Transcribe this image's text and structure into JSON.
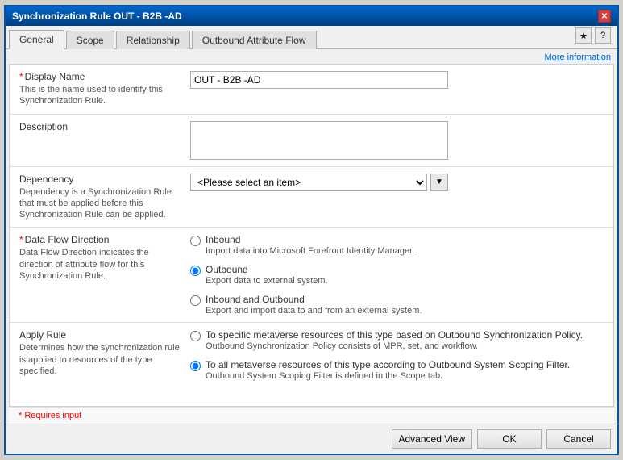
{
  "window": {
    "title": "Synchronization Rule OUT - B2B -AD",
    "close_label": "✕"
  },
  "tabs": [
    {
      "id": "general",
      "label": "General",
      "active": true
    },
    {
      "id": "scope",
      "label": "Scope",
      "active": false
    },
    {
      "id": "relationship",
      "label": "Relationship",
      "active": false
    },
    {
      "id": "outbound",
      "label": "Outbound Attribute Flow",
      "active": false
    }
  ],
  "tab_icons": {
    "star": "★",
    "help": "?"
  },
  "more_info": {
    "label": "More information"
  },
  "fields": {
    "display_name": {
      "label": "Display Name",
      "required": true,
      "description": "This is the name used to identify this Synchronization Rule.",
      "value": "OUT - B2B -AD"
    },
    "description": {
      "label": "Description",
      "value": ""
    },
    "dependency": {
      "label": "Dependency",
      "description": "Dependency is a Synchronization Rule that must be applied before this Synchronization Rule can be applied.",
      "placeholder": "<Please select an item>"
    },
    "data_flow": {
      "label": "Data Flow Direction",
      "required": true,
      "description": "Data Flow Direction indicates the direction of attribute flow for this Synchronization Rule.",
      "options": [
        {
          "id": "inbound",
          "label": "Inbound",
          "description": "Import data into Microsoft Forefront Identity Manager.",
          "checked": false
        },
        {
          "id": "outbound",
          "label": "Outbound",
          "description": "Export data to external system.",
          "checked": true
        },
        {
          "id": "inbound-outbound",
          "label": "Inbound and Outbound",
          "description": "Export and import data to and from an external system.",
          "checked": false
        }
      ]
    },
    "apply_rule": {
      "label": "Apply Rule",
      "description": "Determines how the synchronization rule is applied to resources of the type specified.",
      "options": [
        {
          "id": "specific",
          "label": "To specific metaverse resources of this type based on Outbound Synchronization Policy.",
          "description": "Outbound Synchronization Policy consists of MPR, set, and workflow.",
          "checked": false
        },
        {
          "id": "all",
          "label": "To all metaverse resources of this type according to Outbound System Scoping Filter.",
          "description": "Outbound System Scoping Filter is defined in the Scope tab.",
          "checked": true
        }
      ]
    }
  },
  "footer": {
    "requires_input": "* Requires input",
    "advanced_view": "Advanced View",
    "ok": "OK",
    "cancel": "Cancel"
  }
}
